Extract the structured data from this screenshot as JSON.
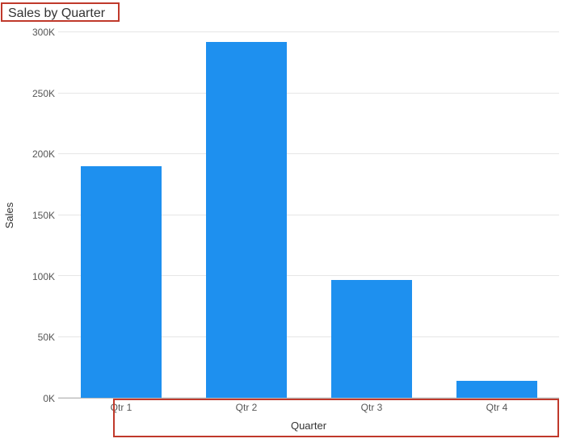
{
  "chart_data": {
    "type": "bar",
    "title": "Sales by Quarter",
    "xlabel": "Quarter",
    "ylabel": "Sales",
    "categories": [
      "Qtr 1",
      "Qtr 2",
      "Qtr 3",
      "Qtr 4"
    ],
    "values": [
      190000,
      292000,
      97000,
      14000
    ],
    "ylim": [
      0,
      300000
    ],
    "y_ticks": [
      "0K",
      "50K",
      "100K",
      "150K",
      "200K",
      "250K",
      "300K"
    ],
    "bar_color": "#1e90ef",
    "highlight_color": "#c0392b"
  }
}
